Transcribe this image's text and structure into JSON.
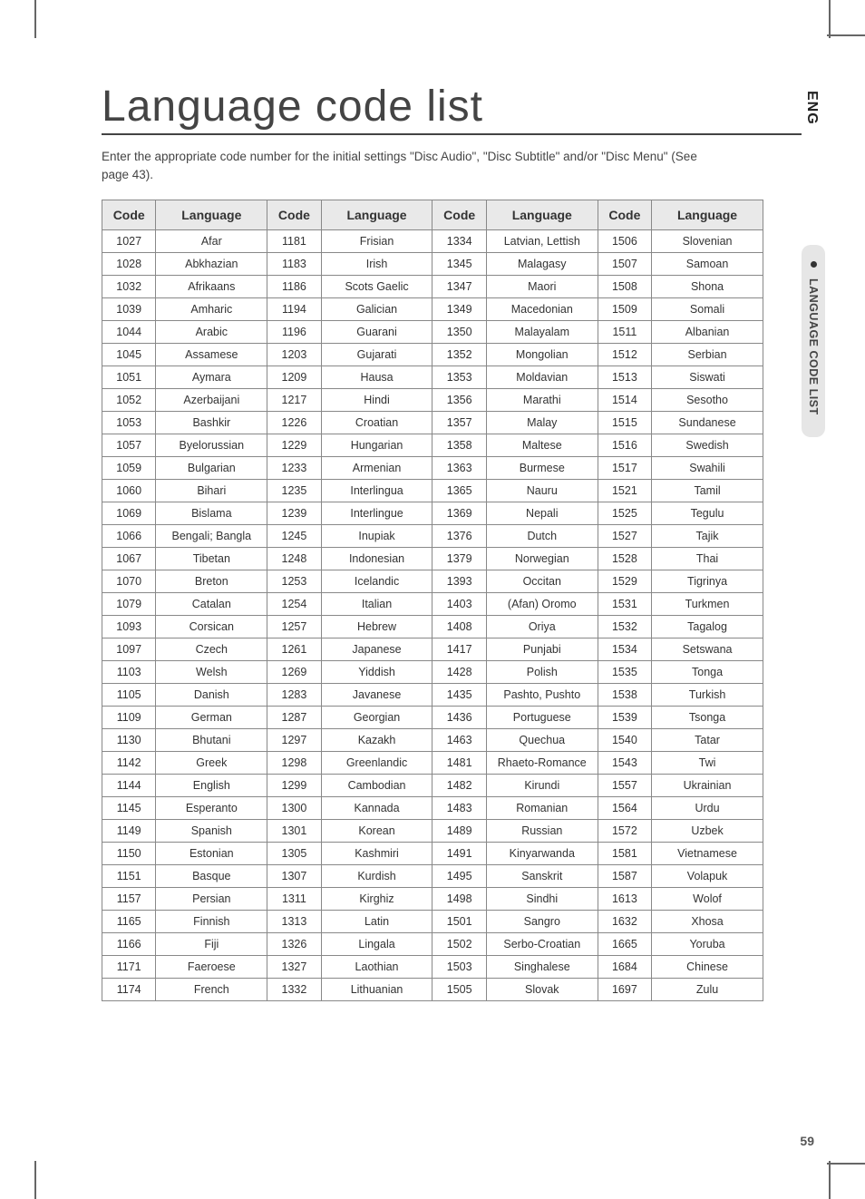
{
  "title": "Language code list",
  "intro": "Enter the appropriate code number for the initial settings \"Disc Audio\", \"Disc Subtitle\" and/or \"Disc Menu\" (See page 43).",
  "headers": {
    "code": "Code",
    "lang": "Language"
  },
  "side": {
    "lang_label": "ENG",
    "section_label": "LANGUAGE CODE LIST"
  },
  "page_number": "59",
  "chart_data": {
    "type": "table",
    "columns": [
      "Code",
      "Language",
      "Code",
      "Language",
      "Code",
      "Language",
      "Code",
      "Language"
    ],
    "rows": [
      [
        "1027",
        "Afar",
        "1181",
        "Frisian",
        "1334",
        "Latvian, Lettish",
        "1506",
        "Slovenian"
      ],
      [
        "1028",
        "Abkhazian",
        "1183",
        "Irish",
        "1345",
        "Malagasy",
        "1507",
        "Samoan"
      ],
      [
        "1032",
        "Afrikaans",
        "1186",
        "Scots Gaelic",
        "1347",
        "Maori",
        "1508",
        "Shona"
      ],
      [
        "1039",
        "Amharic",
        "1194",
        "Galician",
        "1349",
        "Macedonian",
        "1509",
        "Somali"
      ],
      [
        "1044",
        "Arabic",
        "1196",
        "Guarani",
        "1350",
        "Malayalam",
        "1511",
        "Albanian"
      ],
      [
        "1045",
        "Assamese",
        "1203",
        "Gujarati",
        "1352",
        "Mongolian",
        "1512",
        "Serbian"
      ],
      [
        "1051",
        "Aymara",
        "1209",
        "Hausa",
        "1353",
        "Moldavian",
        "1513",
        "Siswati"
      ],
      [
        "1052",
        "Azerbaijani",
        "1217",
        "Hindi",
        "1356",
        "Marathi",
        "1514",
        "Sesotho"
      ],
      [
        "1053",
        "Bashkir",
        "1226",
        "Croatian",
        "1357",
        "Malay",
        "1515",
        "Sundanese"
      ],
      [
        "1057",
        "Byelorussian",
        "1229",
        "Hungarian",
        "1358",
        "Maltese",
        "1516",
        "Swedish"
      ],
      [
        "1059",
        "Bulgarian",
        "1233",
        "Armenian",
        "1363",
        "Burmese",
        "1517",
        "Swahili"
      ],
      [
        "1060",
        "Bihari",
        "1235",
        "Interlingua",
        "1365",
        "Nauru",
        "1521",
        "Tamil"
      ],
      [
        "1069",
        "Bislama",
        "1239",
        "Interlingue",
        "1369",
        "Nepali",
        "1525",
        "Tegulu"
      ],
      [
        "1066",
        "Bengali; Bangla",
        "1245",
        "Inupiak",
        "1376",
        "Dutch",
        "1527",
        "Tajik"
      ],
      [
        "1067",
        "Tibetan",
        "1248",
        "Indonesian",
        "1379",
        "Norwegian",
        "1528",
        "Thai"
      ],
      [
        "1070",
        "Breton",
        "1253",
        "Icelandic",
        "1393",
        "Occitan",
        "1529",
        "Tigrinya"
      ],
      [
        "1079",
        "Catalan",
        "1254",
        "Italian",
        "1403",
        "(Afan) Oromo",
        "1531",
        "Turkmen"
      ],
      [
        "1093",
        "Corsican",
        "1257",
        "Hebrew",
        "1408",
        "Oriya",
        "1532",
        "Tagalog"
      ],
      [
        "1097",
        "Czech",
        "1261",
        "Japanese",
        "1417",
        "Punjabi",
        "1534",
        "Setswana"
      ],
      [
        "1103",
        "Welsh",
        "1269",
        "Yiddish",
        "1428",
        "Polish",
        "1535",
        "Tonga"
      ],
      [
        "1105",
        "Danish",
        "1283",
        "Javanese",
        "1435",
        "Pashto, Pushto",
        "1538",
        "Turkish"
      ],
      [
        "1109",
        "German",
        "1287",
        "Georgian",
        "1436",
        "Portuguese",
        "1539",
        "Tsonga"
      ],
      [
        "1130",
        "Bhutani",
        "1297",
        "Kazakh",
        "1463",
        "Quechua",
        "1540",
        "Tatar"
      ],
      [
        "1142",
        "Greek",
        "1298",
        "Greenlandic",
        "1481",
        "Rhaeto-Romance",
        "1543",
        "Twi"
      ],
      [
        "1144",
        "English",
        "1299",
        "Cambodian",
        "1482",
        "Kirundi",
        "1557",
        "Ukrainian"
      ],
      [
        "1145",
        "Esperanto",
        "1300",
        "Kannada",
        "1483",
        "Romanian",
        "1564",
        "Urdu"
      ],
      [
        "1149",
        "Spanish",
        "1301",
        "Korean",
        "1489",
        "Russian",
        "1572",
        "Uzbek"
      ],
      [
        "1150",
        "Estonian",
        "1305",
        "Kashmiri",
        "1491",
        "Kinyarwanda",
        "1581",
        "Vietnamese"
      ],
      [
        "1151",
        "Basque",
        "1307",
        "Kurdish",
        "1495",
        "Sanskrit",
        "1587",
        "Volapuk"
      ],
      [
        "1157",
        "Persian",
        "1311",
        "Kirghiz",
        "1498",
        "Sindhi",
        "1613",
        "Wolof"
      ],
      [
        "1165",
        "Finnish",
        "1313",
        "Latin",
        "1501",
        "Sangro",
        "1632",
        "Xhosa"
      ],
      [
        "1166",
        "Fiji",
        "1326",
        "Lingala",
        "1502",
        "Serbo-Croatian",
        "1665",
        "Yoruba"
      ],
      [
        "1171",
        "Faeroese",
        "1327",
        "Laothian",
        "1503",
        "Singhalese",
        "1684",
        "Chinese"
      ],
      [
        "1174",
        "French",
        "1332",
        "Lithuanian",
        "1505",
        "Slovak",
        "1697",
        "Zulu"
      ]
    ]
  }
}
